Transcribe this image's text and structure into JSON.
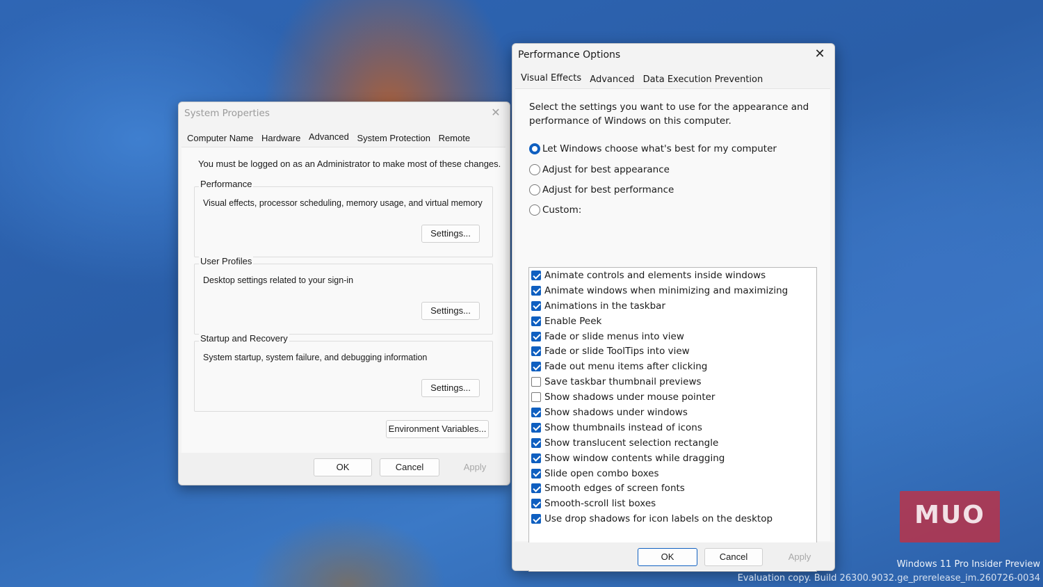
{
  "system_properties": {
    "title": "System Properties",
    "tabs": [
      "Computer Name",
      "Hardware",
      "Advanced",
      "System Protection",
      "Remote"
    ],
    "active_tab": "Advanced",
    "admin_note": "You must be logged on as an Administrator to make most of these changes.",
    "performance": {
      "title": "Performance",
      "description": "Visual effects, processor scheduling, memory usage, and virtual memory",
      "button": "Settings..."
    },
    "user_profiles": {
      "title": "User Profiles",
      "description": "Desktop settings related to your sign-in",
      "button": "Settings..."
    },
    "startup_recovery": {
      "title": "Startup and Recovery",
      "description": "System startup, system failure, and debugging information",
      "button": "Settings..."
    },
    "env_button": "Environment Variables...",
    "ok": "OK",
    "cancel": "Cancel",
    "apply": "Apply"
  },
  "performance_options": {
    "title": "Performance Options",
    "tabs": [
      "Visual Effects",
      "Advanced",
      "Data Execution Prevention"
    ],
    "active_tab": "Visual Effects",
    "intro": "Select the settings you want to use for the appearance and performance of Windows on this computer.",
    "radios": [
      {
        "label": "Let Windows choose what's best for my computer",
        "checked": true
      },
      {
        "label": "Adjust for best appearance",
        "checked": false
      },
      {
        "label": "Adjust for best performance",
        "checked": false
      },
      {
        "label": "Custom:",
        "checked": false
      }
    ],
    "effects": [
      {
        "label": "Animate controls and elements inside windows",
        "checked": true
      },
      {
        "label": "Animate windows when minimizing and maximizing",
        "checked": true
      },
      {
        "label": "Animations in the taskbar",
        "checked": true
      },
      {
        "label": "Enable Peek",
        "checked": true
      },
      {
        "label": "Fade or slide menus into view",
        "checked": true
      },
      {
        "label": "Fade or slide ToolTips into view",
        "checked": true
      },
      {
        "label": "Fade out menu items after clicking",
        "checked": true
      },
      {
        "label": "Save taskbar thumbnail previews",
        "checked": false
      },
      {
        "label": "Show shadows under mouse pointer",
        "checked": false
      },
      {
        "label": "Show shadows under windows",
        "checked": true
      },
      {
        "label": "Show thumbnails instead of icons",
        "checked": true
      },
      {
        "label": "Show translucent selection rectangle",
        "checked": true
      },
      {
        "label": "Show window contents while dragging",
        "checked": true
      },
      {
        "label": "Slide open combo boxes",
        "checked": true
      },
      {
        "label": "Smooth edges of screen fonts",
        "checked": true
      },
      {
        "label": "Smooth-scroll list boxes",
        "checked": true
      },
      {
        "label": "Use drop shadows for icon labels on the desktop",
        "checked": true
      }
    ],
    "ok": "OK",
    "cancel": "Cancel",
    "apply": "Apply"
  },
  "logo": {
    "text": "MUO"
  },
  "watermark": {
    "line1": "Windows 11 Pro Insider Preview",
    "line2": "Evaluation copy. Build 26300.9032.ge_prerelease_im.260726-0034"
  },
  "colors": {
    "accent": "#0f5fc0",
    "logo": "#d72832"
  }
}
